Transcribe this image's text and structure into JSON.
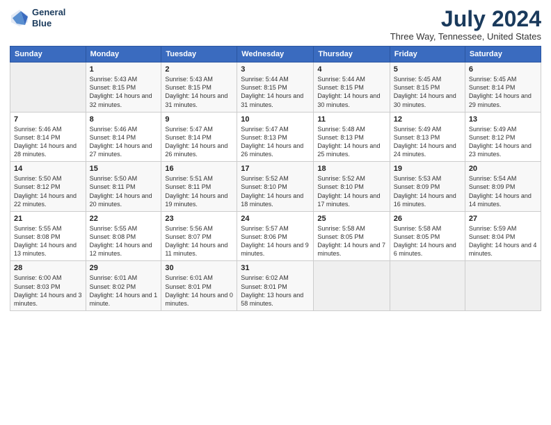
{
  "header": {
    "logo_line1": "General",
    "logo_line2": "Blue",
    "title": "July 2024",
    "subtitle": "Three Way, Tennessee, United States"
  },
  "days_of_week": [
    "Sunday",
    "Monday",
    "Tuesday",
    "Wednesday",
    "Thursday",
    "Friday",
    "Saturday"
  ],
  "weeks": [
    [
      {
        "day": "",
        "sunrise": "",
        "sunset": "",
        "daylight": ""
      },
      {
        "day": "1",
        "sunrise": "Sunrise: 5:43 AM",
        "sunset": "Sunset: 8:15 PM",
        "daylight": "Daylight: 14 hours and 32 minutes."
      },
      {
        "day": "2",
        "sunrise": "Sunrise: 5:43 AM",
        "sunset": "Sunset: 8:15 PM",
        "daylight": "Daylight: 14 hours and 31 minutes."
      },
      {
        "day": "3",
        "sunrise": "Sunrise: 5:44 AM",
        "sunset": "Sunset: 8:15 PM",
        "daylight": "Daylight: 14 hours and 31 minutes."
      },
      {
        "day": "4",
        "sunrise": "Sunrise: 5:44 AM",
        "sunset": "Sunset: 8:15 PM",
        "daylight": "Daylight: 14 hours and 30 minutes."
      },
      {
        "day": "5",
        "sunrise": "Sunrise: 5:45 AM",
        "sunset": "Sunset: 8:15 PM",
        "daylight": "Daylight: 14 hours and 30 minutes."
      },
      {
        "day": "6",
        "sunrise": "Sunrise: 5:45 AM",
        "sunset": "Sunset: 8:14 PM",
        "daylight": "Daylight: 14 hours and 29 minutes."
      }
    ],
    [
      {
        "day": "7",
        "sunrise": "Sunrise: 5:46 AM",
        "sunset": "Sunset: 8:14 PM",
        "daylight": "Daylight: 14 hours and 28 minutes."
      },
      {
        "day": "8",
        "sunrise": "Sunrise: 5:46 AM",
        "sunset": "Sunset: 8:14 PM",
        "daylight": "Daylight: 14 hours and 27 minutes."
      },
      {
        "day": "9",
        "sunrise": "Sunrise: 5:47 AM",
        "sunset": "Sunset: 8:14 PM",
        "daylight": "Daylight: 14 hours and 26 minutes."
      },
      {
        "day": "10",
        "sunrise": "Sunrise: 5:47 AM",
        "sunset": "Sunset: 8:13 PM",
        "daylight": "Daylight: 14 hours and 26 minutes."
      },
      {
        "day": "11",
        "sunrise": "Sunrise: 5:48 AM",
        "sunset": "Sunset: 8:13 PM",
        "daylight": "Daylight: 14 hours and 25 minutes."
      },
      {
        "day": "12",
        "sunrise": "Sunrise: 5:49 AM",
        "sunset": "Sunset: 8:13 PM",
        "daylight": "Daylight: 14 hours and 24 minutes."
      },
      {
        "day": "13",
        "sunrise": "Sunrise: 5:49 AM",
        "sunset": "Sunset: 8:12 PM",
        "daylight": "Daylight: 14 hours and 23 minutes."
      }
    ],
    [
      {
        "day": "14",
        "sunrise": "Sunrise: 5:50 AM",
        "sunset": "Sunset: 8:12 PM",
        "daylight": "Daylight: 14 hours and 22 minutes."
      },
      {
        "day": "15",
        "sunrise": "Sunrise: 5:50 AM",
        "sunset": "Sunset: 8:11 PM",
        "daylight": "Daylight: 14 hours and 20 minutes."
      },
      {
        "day": "16",
        "sunrise": "Sunrise: 5:51 AM",
        "sunset": "Sunset: 8:11 PM",
        "daylight": "Daylight: 14 hours and 19 minutes."
      },
      {
        "day": "17",
        "sunrise": "Sunrise: 5:52 AM",
        "sunset": "Sunset: 8:10 PM",
        "daylight": "Daylight: 14 hours and 18 minutes."
      },
      {
        "day": "18",
        "sunrise": "Sunrise: 5:52 AM",
        "sunset": "Sunset: 8:10 PM",
        "daylight": "Daylight: 14 hours and 17 minutes."
      },
      {
        "day": "19",
        "sunrise": "Sunrise: 5:53 AM",
        "sunset": "Sunset: 8:09 PM",
        "daylight": "Daylight: 14 hours and 16 minutes."
      },
      {
        "day": "20",
        "sunrise": "Sunrise: 5:54 AM",
        "sunset": "Sunset: 8:09 PM",
        "daylight": "Daylight: 14 hours and 14 minutes."
      }
    ],
    [
      {
        "day": "21",
        "sunrise": "Sunrise: 5:55 AM",
        "sunset": "Sunset: 8:08 PM",
        "daylight": "Daylight: 14 hours and 13 minutes."
      },
      {
        "day": "22",
        "sunrise": "Sunrise: 5:55 AM",
        "sunset": "Sunset: 8:08 PM",
        "daylight": "Daylight: 14 hours and 12 minutes."
      },
      {
        "day": "23",
        "sunrise": "Sunrise: 5:56 AM",
        "sunset": "Sunset: 8:07 PM",
        "daylight": "Daylight: 14 hours and 11 minutes."
      },
      {
        "day": "24",
        "sunrise": "Sunrise: 5:57 AM",
        "sunset": "Sunset: 8:06 PM",
        "daylight": "Daylight: 14 hours and 9 minutes."
      },
      {
        "day": "25",
        "sunrise": "Sunrise: 5:58 AM",
        "sunset": "Sunset: 8:05 PM",
        "daylight": "Daylight: 14 hours and 7 minutes."
      },
      {
        "day": "26",
        "sunrise": "Sunrise: 5:58 AM",
        "sunset": "Sunset: 8:05 PM",
        "daylight": "Daylight: 14 hours and 6 minutes."
      },
      {
        "day": "27",
        "sunrise": "Sunrise: 5:59 AM",
        "sunset": "Sunset: 8:04 PM",
        "daylight": "Daylight: 14 hours and 4 minutes."
      }
    ],
    [
      {
        "day": "28",
        "sunrise": "Sunrise: 6:00 AM",
        "sunset": "Sunset: 8:03 PM",
        "daylight": "Daylight: 14 hours and 3 minutes."
      },
      {
        "day": "29",
        "sunrise": "Sunrise: 6:01 AM",
        "sunset": "Sunset: 8:02 PM",
        "daylight": "Daylight: 14 hours and 1 minute."
      },
      {
        "day": "30",
        "sunrise": "Sunrise: 6:01 AM",
        "sunset": "Sunset: 8:01 PM",
        "daylight": "Daylight: 14 hours and 0 minutes."
      },
      {
        "day": "31",
        "sunrise": "Sunrise: 6:02 AM",
        "sunset": "Sunset: 8:01 PM",
        "daylight": "Daylight: 13 hours and 58 minutes."
      },
      {
        "day": "",
        "sunrise": "",
        "sunset": "",
        "daylight": ""
      },
      {
        "day": "",
        "sunrise": "",
        "sunset": "",
        "daylight": ""
      },
      {
        "day": "",
        "sunrise": "",
        "sunset": "",
        "daylight": ""
      }
    ]
  ]
}
